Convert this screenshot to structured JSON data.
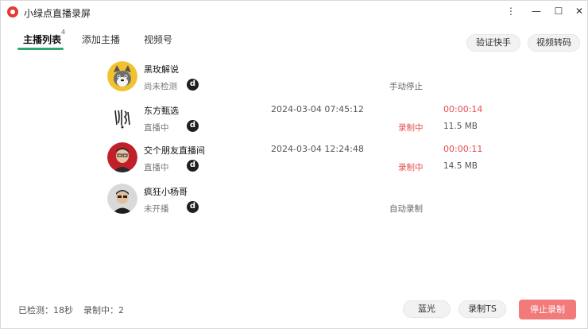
{
  "app": {
    "title": "小绿点直播录屏"
  },
  "window_controls": {
    "menu": "⋮",
    "minimize": "—",
    "maximize": "☐",
    "close": "✕"
  },
  "tabs": [
    {
      "label": "主播列表",
      "count": "4"
    },
    {
      "label": "添加主播"
    },
    {
      "label": "视频号"
    }
  ],
  "toolbar": {
    "verify_label": "验证快手",
    "transcode_label": "视频转码"
  },
  "streamers": [
    {
      "name": "黑玫解说",
      "status": "尚未检测",
      "platform_icon": "d",
      "time": "",
      "duration": "",
      "rec_state": "",
      "size": "",
      "mode": "手动停止"
    },
    {
      "name": "东方甄选",
      "status": "直播中",
      "platform_icon": "d",
      "time": "2024-03-04 07:45:12",
      "duration": "00:00:14",
      "rec_state": "录制中",
      "size": "11.5 MB",
      "mode": ""
    },
    {
      "name": "交个朋友直播间",
      "status": "直播中",
      "platform_icon": "d",
      "time": "2024-03-04 12:24:48",
      "duration": "00:00:11",
      "rec_state": "录制中",
      "size": "14.5 MB",
      "mode": ""
    },
    {
      "name": "疯狂小杨哥",
      "status": "未开播",
      "platform_icon": "d",
      "time": "",
      "duration": "",
      "rec_state": "",
      "size": "",
      "mode": "自动录制"
    }
  ],
  "footer": {
    "detected": "已检测：18秒",
    "recording": "录制中：2",
    "blue_label": "蓝光",
    "ts_label": "录制TS",
    "stop_label": "停止录制"
  },
  "colors": {
    "accent": "#2ea86b",
    "danger": "#e54d4d",
    "stop_button": "#f27a7a"
  }
}
